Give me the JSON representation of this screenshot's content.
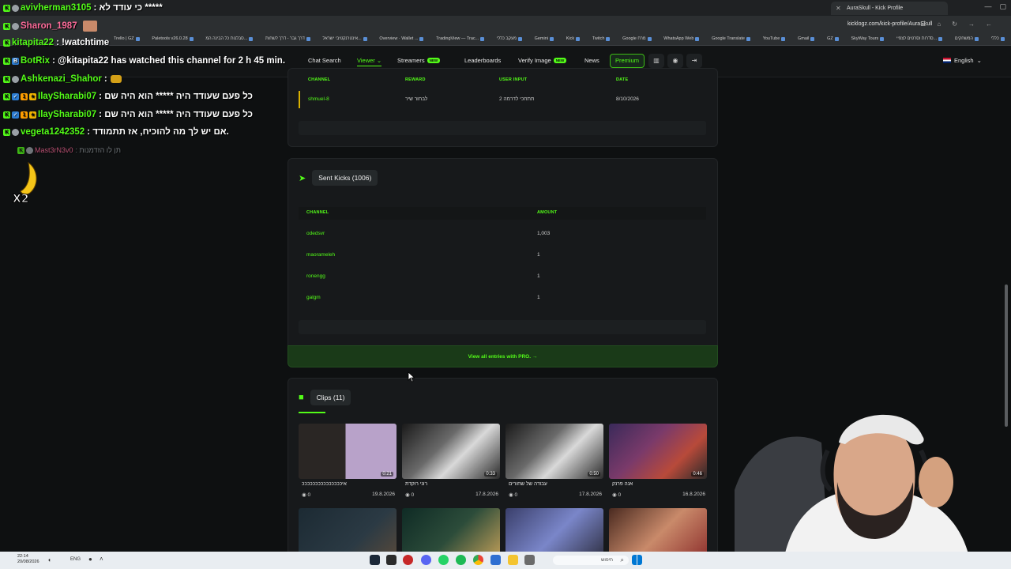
{
  "browser": {
    "tab_title": "AuraSkull - Kick Profile",
    "url": "kicklogz.com/kick-profile/AuraSkull",
    "bookmarks": [
      "Trello | GZ",
      "Paletools v26.0.28",
      "סבלנות כל הבינה המ...",
      "דרך גבר - דרך לשחות",
      "אינטרנקטיבי ישראל...",
      "Overview · Wallet ...",
      "TradingView — Trac...",
      "מעקב כללי",
      "Gemini",
      "Kick",
      "Twitch",
      "Google מרח",
      "WhatsApp Web",
      "Google Translate",
      "YouTube",
      "Gmail",
      "GZ",
      "SkyWay Tours",
      "סדרות וסרטים לצפיי...",
      "המשחקים",
      "כללי"
    ]
  },
  "nav": {
    "chat_search": "Chat Search",
    "viewer": "Viewer",
    "streamers": "Streamers",
    "new_badge": "NEW",
    "leaderboards": "Leaderboards",
    "verify_image": "Verify Image",
    "news": "News",
    "premium": "Premium",
    "language": "English"
  },
  "chat": [
    {
      "user": "avivherman3105",
      "text": ": כי עודד לא *****"
    },
    {
      "user": "Sharon_1987",
      "text": ""
    },
    {
      "user": "kitapita22",
      "text": ": !watchtime"
    },
    {
      "user": "BotRix",
      "text": ": @kitapita22 has watched this channel for 2 h 45 min."
    },
    {
      "user": "Ashkenazi_Shahor",
      "text": ":"
    },
    {
      "user": "IlaySharabi07",
      "text": ": כל פעם שעודד היה ***** הוא היה שם"
    },
    {
      "user": "IlaySharabi07",
      "text": ": כל פעם שעודד היה ***** הוא היה שם"
    },
    {
      "user": "vegeta1242352",
      "text": ": אם יש לך מה להוכיח, אז תתמודד."
    },
    {
      "user": "Mast3rN3v0",
      "text": ": תן לו הזדמנות"
    }
  ],
  "rewards_table": {
    "headers": [
      "CHANNEL",
      "REWARD",
      "USER INPUT",
      "DATE"
    ],
    "rows": [
      {
        "channel": "shmuel-8",
        "reward": "לבחור שיר",
        "input": "תתחכי לדרמה 2",
        "date": "8/10/2026"
      }
    ]
  },
  "sent_kicks": {
    "title": "Sent Kicks (1006)",
    "headers": [
      "CHANNEL",
      "AMOUNT"
    ],
    "rows": [
      {
        "channel": "odedsvr",
        "amount": "1,003"
      },
      {
        "channel": "maorameleh",
        "amount": "1"
      },
      {
        "channel": "ronengg",
        "amount": "1"
      },
      {
        "channel": "galgm",
        "amount": "1"
      }
    ],
    "cta": "View all entries with PRO. →"
  },
  "clips": {
    "title": "Clips (11)",
    "items": [
      {
        "title": "איכככככככככככככככ",
        "duration": "0:21",
        "views": "0",
        "date": "19.8.2026"
      },
      {
        "title": "רוני רוקדת",
        "duration": "0:33",
        "views": "0",
        "date": "17.8.2026"
      },
      {
        "title": "עבודה של שחורים",
        "duration": "0:50",
        "views": "0",
        "date": "17.8.2026"
      },
      {
        "title": "אנה פרנק",
        "duration": "0:46",
        "views": "0",
        "date": "16.8.2026"
      }
    ]
  },
  "taskbar": {
    "time": "22:14",
    "date": "20/08/2026",
    "lang": "ENG",
    "search": "חיפוש"
  },
  "colors": {
    "kick_green": "#53fc18",
    "panel_bg": "#17191b",
    "page_bg": "#0e1011"
  }
}
